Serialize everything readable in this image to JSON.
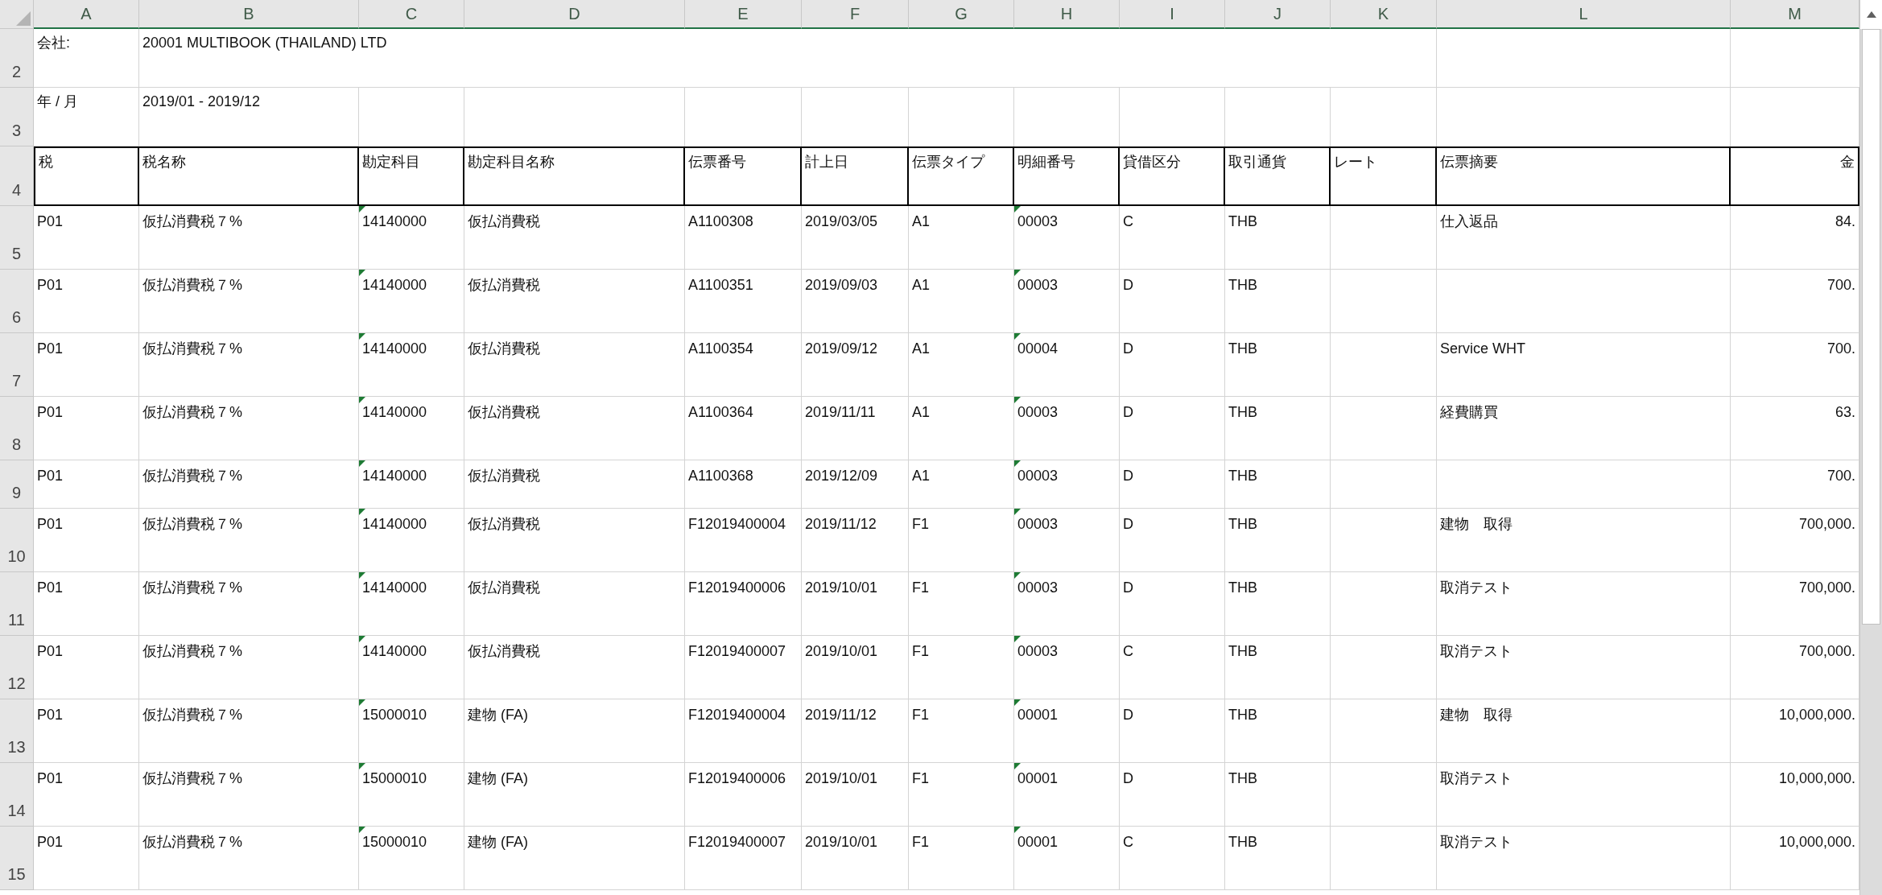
{
  "column_headers": [
    "A",
    "B",
    "C",
    "D",
    "E",
    "F",
    "G",
    "H",
    "I",
    "J",
    "K",
    "L",
    "M"
  ],
  "rows": [
    {
      "number": "2",
      "kind": "info",
      "label": "会社:",
      "value": "20001 MULTIBOOK (THAILAND) LTD"
    },
    {
      "number": "3",
      "kind": "info",
      "label": "年 / 月",
      "value": "2019/01 - 2019/12"
    },
    {
      "number": "4",
      "kind": "heading",
      "cells": [
        "税",
        "税名称",
        "勘定科目",
        "勘定科目名称",
        "伝票番号",
        "計上日",
        "伝票タイプ",
        "明細番号",
        "貸借区分",
        "取引通貨",
        "レート",
        "伝票摘要",
        "金"
      ]
    },
    {
      "number": "5",
      "kind": "data",
      "cells": [
        {
          "text": "P01",
          "flagged": false
        },
        {
          "text": "仮払消費税７%",
          "flagged": false
        },
        {
          "text": "14140000",
          "flagged": true
        },
        {
          "text": "仮払消費税",
          "flagged": false
        },
        {
          "text": "A1100308",
          "flagged": false
        },
        {
          "text": "2019/03/05",
          "flagged": false
        },
        {
          "text": "A1",
          "flagged": false
        },
        {
          "text": "00003",
          "flagged": true
        },
        {
          "text": "C",
          "flagged": false
        },
        {
          "text": "THB",
          "flagged": false
        },
        {
          "flagged": false
        },
        {
          "text": "仕入返品",
          "flagged": false
        },
        {
          "text": "84.",
          "flagged": false
        }
      ]
    },
    {
      "number": "6",
      "kind": "data",
      "cells": [
        {
          "text": "P01",
          "flagged": false
        },
        {
          "text": "仮払消費税７%",
          "flagged": false
        },
        {
          "text": "14140000",
          "flagged": true
        },
        {
          "text": "仮払消費税",
          "flagged": false
        },
        {
          "text": "A1100351",
          "flagged": false
        },
        {
          "text": "2019/09/03",
          "flagged": false
        },
        {
          "text": "A1",
          "flagged": false
        },
        {
          "text": "00003",
          "flagged": true
        },
        {
          "text": "D",
          "flagged": false
        },
        {
          "text": "THB",
          "flagged": false
        },
        {
          "flagged": false
        },
        {
          "flagged": false
        },
        {
          "text": "700.",
          "flagged": false
        }
      ]
    },
    {
      "number": "7",
      "kind": "data",
      "cells": [
        {
          "text": "P01",
          "flagged": false
        },
        {
          "text": "仮払消費税７%",
          "flagged": false
        },
        {
          "text": "14140000",
          "flagged": true
        },
        {
          "text": "仮払消費税",
          "flagged": false
        },
        {
          "text": "A1100354",
          "flagged": false
        },
        {
          "text": "2019/09/12",
          "flagged": false
        },
        {
          "text": "A1",
          "flagged": false
        },
        {
          "text": "00004",
          "flagged": true
        },
        {
          "text": "D",
          "flagged": false
        },
        {
          "text": "THB",
          "flagged": false
        },
        {
          "flagged": false
        },
        {
          "text": "Service WHT",
          "flagged": false
        },
        {
          "text": "700.",
          "flagged": false
        }
      ]
    },
    {
      "number": "8",
      "kind": "data",
      "cells": [
        {
          "text": "P01",
          "flagged": false
        },
        {
          "text": "仮払消費税７%",
          "flagged": false
        },
        {
          "text": "14140000",
          "flagged": true
        },
        {
          "text": "仮払消費税",
          "flagged": false
        },
        {
          "text": "A1100364",
          "flagged": false
        },
        {
          "text": "2019/11/11",
          "flagged": false
        },
        {
          "text": "A1",
          "flagged": false
        },
        {
          "text": "00003",
          "flagged": true
        },
        {
          "text": "D",
          "flagged": false
        },
        {
          "text": "THB",
          "flagged": false
        },
        {
          "flagged": false
        },
        {
          "text": "経費購買",
          "flagged": false
        },
        {
          "text": "63.",
          "flagged": false
        }
      ]
    },
    {
      "number": "9",
      "kind": "data",
      "cells": [
        {
          "text": "P01",
          "flagged": false
        },
        {
          "text": "仮払消費税７%",
          "flagged": false
        },
        {
          "text": "14140000",
          "flagged": true
        },
        {
          "text": "仮払消費税",
          "flagged": false
        },
        {
          "text": "A1100368",
          "flagged": false
        },
        {
          "text": "2019/12/09",
          "flagged": false
        },
        {
          "text": "A1",
          "flagged": false
        },
        {
          "text": "00003",
          "flagged": true
        },
        {
          "text": "D",
          "flagged": false
        },
        {
          "text": "THB",
          "flagged": false
        },
        {
          "flagged": false
        },
        {
          "flagged": false
        },
        {
          "text": "700.",
          "flagged": false
        }
      ]
    },
    {
      "number": "10",
      "kind": "data",
      "cells": [
        {
          "text": "P01",
          "flagged": false
        },
        {
          "text": "仮払消費税７%",
          "flagged": false
        },
        {
          "text": "14140000",
          "flagged": true
        },
        {
          "text": "仮払消費税",
          "flagged": false
        },
        {
          "text": "F12019400004",
          "flagged": false
        },
        {
          "text": "2019/11/12",
          "flagged": false
        },
        {
          "text": "F1",
          "flagged": false
        },
        {
          "text": "00003",
          "flagged": true
        },
        {
          "text": "D",
          "flagged": false
        },
        {
          "text": "THB",
          "flagged": false
        },
        {
          "flagged": false
        },
        {
          "text": "建物　取得",
          "flagged": false
        },
        {
          "text": "700,000.",
          "flagged": false
        }
      ]
    },
    {
      "number": "11",
      "kind": "data",
      "cells": [
        {
          "text": "P01",
          "flagged": false
        },
        {
          "text": "仮払消費税７%",
          "flagged": false
        },
        {
          "text": "14140000",
          "flagged": true
        },
        {
          "text": "仮払消費税",
          "flagged": false
        },
        {
          "text": "F12019400006",
          "flagged": false
        },
        {
          "text": "2019/10/01",
          "flagged": false
        },
        {
          "text": "F1",
          "flagged": false
        },
        {
          "text": "00003",
          "flagged": true
        },
        {
          "text": "D",
          "flagged": false
        },
        {
          "text": "THB",
          "flagged": false
        },
        {
          "flagged": false
        },
        {
          "text": "取消テスト",
          "flagged": false
        },
        {
          "text": "700,000.",
          "flagged": false
        }
      ]
    },
    {
      "number": "12",
      "kind": "data",
      "cells": [
        {
          "text": "P01",
          "flagged": false
        },
        {
          "text": "仮払消費税７%",
          "flagged": false
        },
        {
          "text": "14140000",
          "flagged": true
        },
        {
          "text": "仮払消費税",
          "flagged": false
        },
        {
          "text": "F12019400007",
          "flagged": false
        },
        {
          "text": "2019/10/01",
          "flagged": false
        },
        {
          "text": "F1",
          "flagged": false
        },
        {
          "text": "00003",
          "flagged": true
        },
        {
          "text": "C",
          "flagged": false
        },
        {
          "text": "THB",
          "flagged": false
        },
        {
          "flagged": false
        },
        {
          "text": "取消テスト",
          "flagged": false
        },
        {
          "text": "700,000.",
          "flagged": false
        }
      ]
    },
    {
      "number": "13",
      "kind": "data",
      "cells": [
        {
          "text": "P01",
          "flagged": false
        },
        {
          "text": "仮払消費税７%",
          "flagged": false
        },
        {
          "text": "15000010",
          "flagged": true
        },
        {
          "text": "建物 (FA)",
          "flagged": false
        },
        {
          "text": "F12019400004",
          "flagged": false
        },
        {
          "text": "2019/11/12",
          "flagged": false
        },
        {
          "text": "F1",
          "flagged": false
        },
        {
          "text": "00001",
          "flagged": true
        },
        {
          "text": "D",
          "flagged": false
        },
        {
          "text": "THB",
          "flagged": false
        },
        {
          "flagged": false
        },
        {
          "text": "建物　取得",
          "flagged": false
        },
        {
          "text": "10,000,000.",
          "flagged": false
        }
      ]
    },
    {
      "number": "14",
      "kind": "data",
      "cells": [
        {
          "text": "P01",
          "flagged": false
        },
        {
          "text": "仮払消費税７%",
          "flagged": false
        },
        {
          "text": "15000010",
          "flagged": true
        },
        {
          "text": "建物 (FA)",
          "flagged": false
        },
        {
          "text": "F12019400006",
          "flagged": false
        },
        {
          "text": "2019/10/01",
          "flagged": false
        },
        {
          "text": "F1",
          "flagged": false
        },
        {
          "text": "00001",
          "flagged": true
        },
        {
          "text": "D",
          "flagged": false
        },
        {
          "text": "THB",
          "flagged": false
        },
        {
          "flagged": false
        },
        {
          "text": "取消テスト",
          "flagged": false
        },
        {
          "text": "10,000,000.",
          "flagged": false
        }
      ]
    },
    {
      "number": "15",
      "kind": "data",
      "cells": [
        {
          "text": "P01",
          "flagged": false
        },
        {
          "text": "仮払消費税７%",
          "flagged": false
        },
        {
          "text": "15000010",
          "flagged": true
        },
        {
          "text": "建物 (FA)",
          "flagged": false
        },
        {
          "text": "F12019400007",
          "flagged": false
        },
        {
          "text": "2019/10/01",
          "flagged": false
        },
        {
          "text": "F1",
          "flagged": false
        },
        {
          "text": "00001",
          "flagged": true
        },
        {
          "text": "C",
          "flagged": false
        },
        {
          "text": "THB",
          "flagged": false
        },
        {
          "flagged": false
        },
        {
          "text": "取消テスト",
          "flagged": false
        },
        {
          "text": "10,000,000.",
          "flagged": false
        }
      ]
    }
  ]
}
